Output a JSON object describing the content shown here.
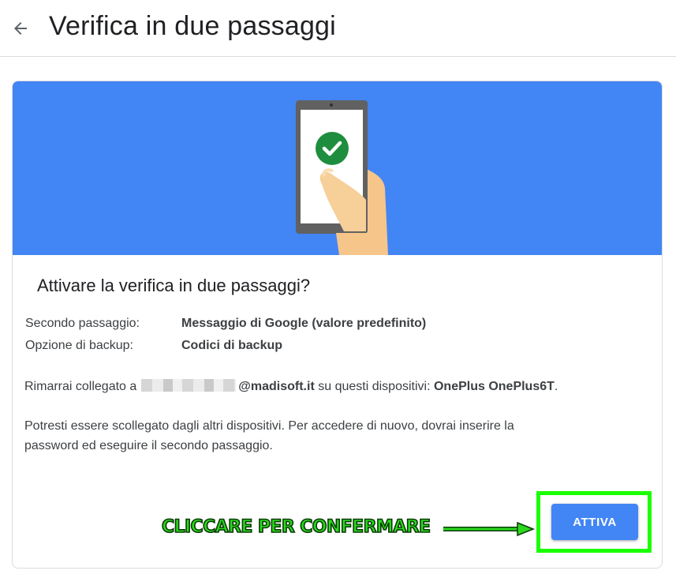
{
  "header": {
    "title": "Verifica in due passaggi",
    "back_icon": "arrow-left-icon"
  },
  "card": {
    "title": "Attivare la verifica in due passaggi?",
    "details": [
      {
        "label": "Secondo passaggio:",
        "value": "Messaggio di Google (valore predefinito)"
      },
      {
        "label": "Opzione di backup:",
        "value": "Codici di backup"
      }
    ],
    "signed_in": {
      "prefix": "Rimarrai collegato a",
      "email_domain": "@madisoft.it",
      "middle": " su questi dispositivi: ",
      "device": "OnePlus OnePlus6T",
      "suffix": "."
    },
    "warning_line1": "Potresti essere scollegato dagli altri dispositivi. Per accedere di nuovo, dovrai inserire la",
    "warning_line2": "password ed eseguire il secondo passaggio.",
    "activate_label": "ATTIVA"
  },
  "annotation": {
    "text": "CLICCARE PER CONFERMARE",
    "color": "#2bd81e"
  },
  "colors": {
    "banner": "#4285f4",
    "button": "#4285f4",
    "check": "#1e8e3e",
    "highlight": "#1aff00"
  }
}
